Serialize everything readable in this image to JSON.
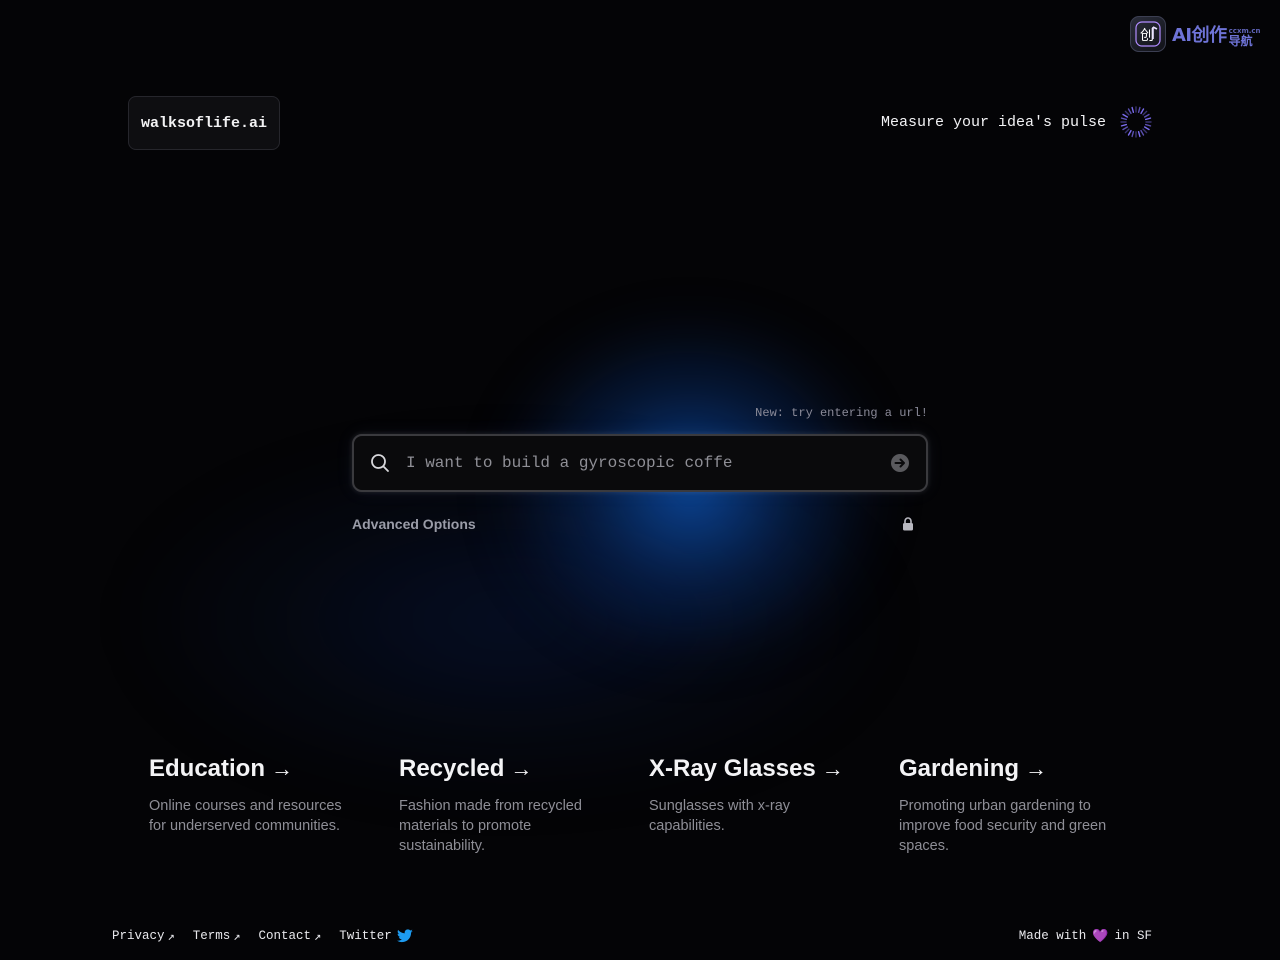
{
  "corner_badge": {
    "logo_glyph": "创",
    "text_main": "AI创作",
    "text_small_top": "ccxm.cn",
    "text_small_bottom": "导航"
  },
  "header": {
    "brand": "walksoflife.ai",
    "pulse_link": "Measure your idea's pulse",
    "spinner_icon": "radial-spinner-icon",
    "accent_color": "#7b6cf0"
  },
  "search": {
    "hint": "New: try entering a url!",
    "placeholder": "I want to build a gyroscopic coffe",
    "value": "",
    "search_icon": "search-icon",
    "submit_icon": "arrow-right-circle-icon",
    "advanced_label": "Advanced Options",
    "lock_icon": "lock-icon"
  },
  "cards": [
    {
      "title": "Education",
      "arrow": "→",
      "description": "Online courses and resources for underserved communities."
    },
    {
      "title": "Recycled",
      "arrow": "→",
      "description": "Fashion made from recycled materials to promote sustainability."
    },
    {
      "title": "X-Ray Glasses",
      "arrow": "→",
      "description": "Sunglasses with x-ray capabilities."
    },
    {
      "title": "Gardening",
      "arrow": "→",
      "description": "Promoting urban gardening to improve food security and green spaces."
    }
  ],
  "footer": {
    "links": [
      {
        "label": "Privacy",
        "icon": "external-link-icon",
        "glyph": "↗"
      },
      {
        "label": "Terms",
        "icon": "external-link-icon",
        "glyph": "↗"
      },
      {
        "label": "Contact",
        "icon": "external-link-icon",
        "glyph": "↗"
      },
      {
        "label": "Twitter",
        "icon": "twitter-bird-icon"
      }
    ],
    "made_with_prefix": "Made with",
    "heart": "💜",
    "made_with_suffix": "in SF",
    "twitter_color": "#1d9bf0"
  }
}
